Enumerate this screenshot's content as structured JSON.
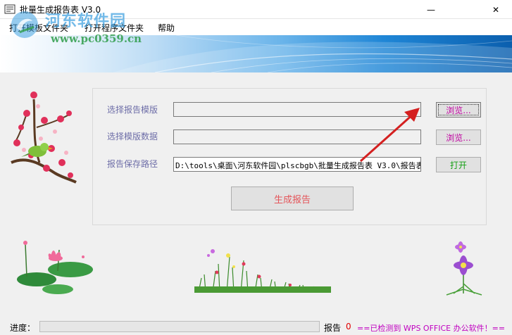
{
  "window": {
    "title": "批量生成报告表 V3.0",
    "minimize_glyph": "—",
    "close_glyph": "✕"
  },
  "menu": {
    "items": [
      {
        "label": "打开模板文件夹"
      },
      {
        "label": "打开程序文件夹"
      },
      {
        "label": "帮助"
      }
    ]
  },
  "watermark": {
    "name": "河东软件园",
    "url": "www.pc0359.cn"
  },
  "form": {
    "template_label": "选择报告模版",
    "template_value": "",
    "data_label": "选择模版数据",
    "data_value": "",
    "save_path_label": "报告保存路径",
    "save_path_value": "D:\\tools\\桌面\\河东软件园\\plscbgb\\批量生成报告表 V3.0\\报告表",
    "browse_template_label": "浏览...",
    "browse_data_label": "浏览...",
    "open_label": "打开",
    "generate_label": "生成报告"
  },
  "status": {
    "progress_label": "进度：",
    "progress_fraction": 0,
    "report_label": "报告",
    "report_count": "0",
    "message": "==已检测到 WPS OFFICE 办公软件！=="
  },
  "colors": {
    "label_text": "#6e6ea8",
    "browse_text": "#c000a0",
    "open_text": "#15a015",
    "generate_text": "#e4555a",
    "arrow": "#d42020",
    "status_message": "#c000c0",
    "report_count": "#e00000"
  }
}
